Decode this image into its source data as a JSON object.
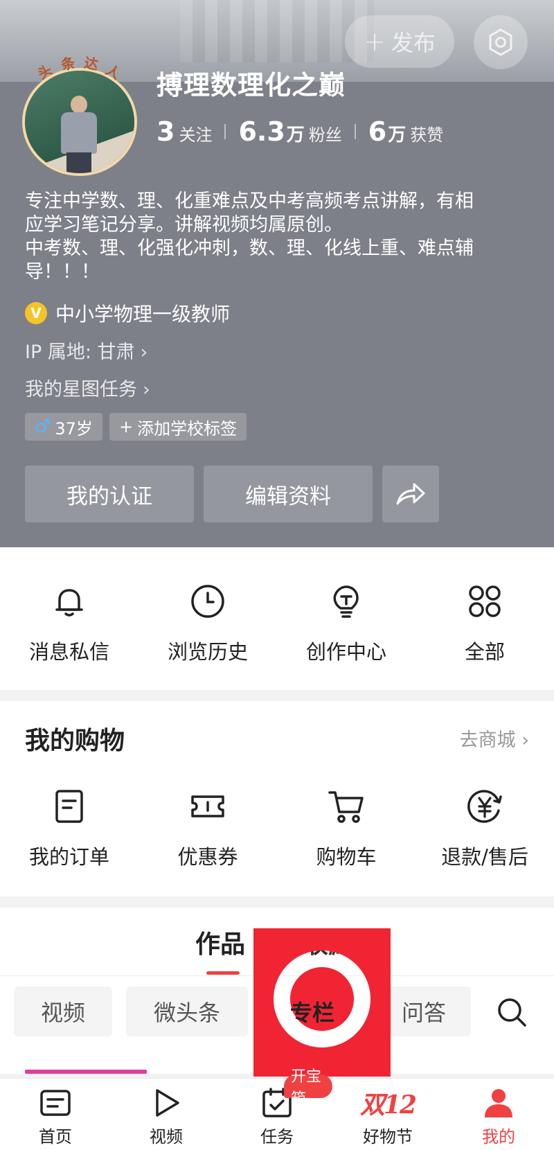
{
  "header": {
    "publish_label": "发布",
    "username": "搏理数理化之巅",
    "avatar_badge": [
      "头",
      "条",
      "达",
      "人"
    ],
    "stats": [
      {
        "num": "3",
        "unit": "",
        "label": "关注"
      },
      {
        "num": "6.3",
        "unit": "万",
        "label": "粉丝"
      },
      {
        "num": "6",
        "unit": "万",
        "label": "获赞"
      }
    ],
    "bio_lines": [
      "专注中学数、理、化重难点及中考高频考点讲解，有相",
      "应学习笔记分享。讲解视频均属原创。",
      "中考数、理、化强化冲刺，数、理、化线上重、难点辅",
      "导！！！"
    ],
    "verified_icon": "V",
    "verified_title": "中小学物理一级教师",
    "ip_location": "IP 属地: 甘肃",
    "star_task": "我的星图任务",
    "chevron": "›",
    "age_tag": "37岁",
    "school_tag": "添加学校标签",
    "buttons": {
      "certify": "我的认证",
      "edit": "编辑资料"
    }
  },
  "quick_actions": [
    {
      "label": "消息私信",
      "icon": "bell-icon"
    },
    {
      "label": "浏览历史",
      "icon": "clock-icon"
    },
    {
      "label": "创作中心",
      "icon": "lightbulb-icon"
    },
    {
      "label": "全部",
      "icon": "grid-icon"
    }
  ],
  "shopping": {
    "title": "我的购物",
    "more": "去商城",
    "items": [
      {
        "label": "我的订单",
        "icon": "order-icon"
      },
      {
        "label": "优惠券",
        "icon": "coupon-icon"
      },
      {
        "label": "购物车",
        "icon": "cart-icon"
      },
      {
        "label": "退款/售后",
        "icon": "refund-icon"
      }
    ]
  },
  "content_tabs": {
    "tabs": [
      "作品",
      "收藏"
    ],
    "chips": [
      "视频",
      "微头条",
      "专栏",
      "问答"
    ]
  },
  "bottom_nav": [
    {
      "label": "首页",
      "icon": "home-icon"
    },
    {
      "label": "视频",
      "icon": "play-icon"
    },
    {
      "label": "任务",
      "icon": "task-icon",
      "badge": "开宝箱"
    },
    {
      "label": "好物节",
      "icon": "promo-logo",
      "logo_text": "双12"
    },
    {
      "label": "我的",
      "icon": "person-icon"
    }
  ],
  "colors": {
    "accent": "#f04142",
    "header_bg": "#7d8088",
    "marker": "#f12434"
  }
}
